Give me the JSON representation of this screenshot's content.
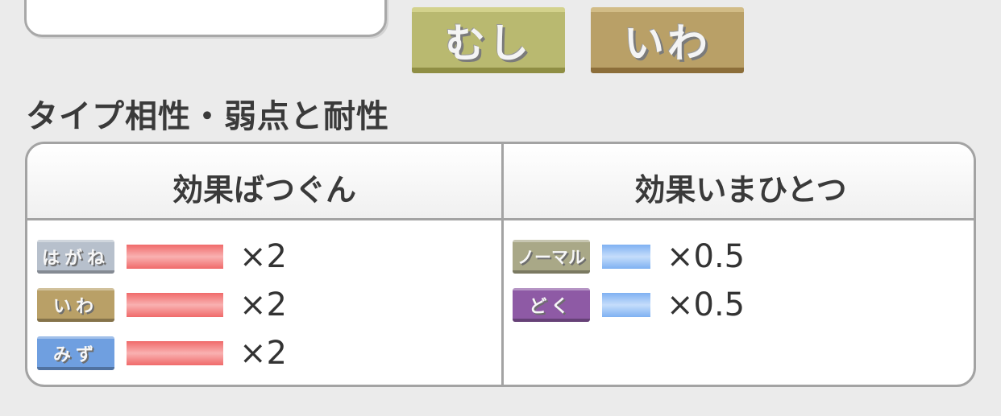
{
  "pokemon_types": [
    {
      "label": "むし",
      "color": "#b9b970"
    },
    {
      "label": "いわ",
      "color": "#b9a067"
    }
  ],
  "section_title": "タイプ相性・弱点と耐性",
  "table": {
    "weak_header": "効果ばつぐん",
    "resist_header": "効果いまひとつ",
    "weaknesses": [
      {
        "type": "はがね",
        "color": "#b7c0cc",
        "multiplier": "×2"
      },
      {
        "type": "いわ",
        "color": "#b9a067",
        "multiplier": "×2"
      },
      {
        "type": "みず",
        "color": "#6f9fe0",
        "multiplier": "×2"
      }
    ],
    "resistances": [
      {
        "type": "ノーマル",
        "color": "#a9a887",
        "multiplier": "×0.5"
      },
      {
        "type": "どく",
        "color": "#8e5aa5",
        "multiplier": "×0.5"
      }
    ]
  },
  "colors": {
    "weak_bar": "#f08080",
    "resist_bar": "#9cc4f6"
  }
}
